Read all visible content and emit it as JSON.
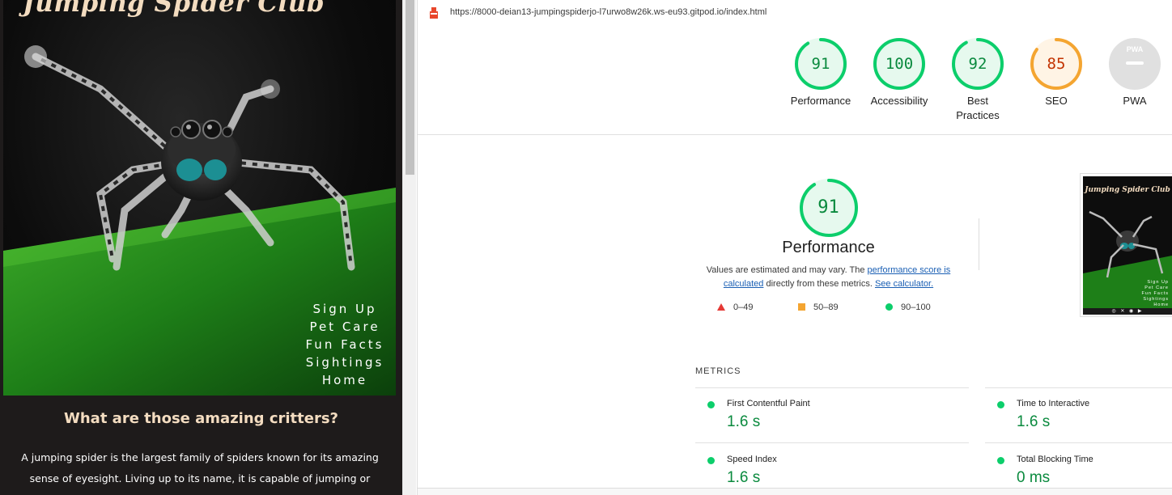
{
  "site": {
    "title": "Jumping Spider Club",
    "nav": [
      "Sign Up",
      "Pet Care",
      "Fun Facts",
      "Sightings",
      "Home"
    ],
    "heading": "What are those amazing critters?",
    "paragraph": "A jumping spider is the largest family of spiders known for its amazing sense of eyesight. Living up to its name, it is capable of jumping or"
  },
  "report": {
    "url": "https://8000-deian13-jumpingspiderjo-l7urwo8w26k.ws-eu93.gitpod.io/index.html",
    "gauges": [
      {
        "label": "Performance",
        "value": "91",
        "score": 0.91,
        "color": "#0cce6b",
        "text_color": "#0a8a3e",
        "bg": "#e6f9ee"
      },
      {
        "label": "Accessibility",
        "value": "100",
        "score": 1.0,
        "color": "#0cce6b",
        "text_color": "#0a8a3e",
        "bg": "#e6f9ee"
      },
      {
        "label": "Best Practices",
        "value": "92",
        "score": 0.92,
        "color": "#0cce6b",
        "text_color": "#0a8a3e",
        "bg": "#e6f9ee"
      },
      {
        "label": "SEO",
        "value": "85",
        "score": 0.85,
        "color": "#f4a531",
        "text_color": "#c33300",
        "bg": "#fff4e5"
      },
      {
        "label": "PWA",
        "value": "PWA",
        "score": 0,
        "color": "#e0e0e0",
        "text_color": "#ffffff",
        "bg": "#e0e0e0"
      }
    ],
    "performance": {
      "score": "91",
      "score_fraction": 0.91,
      "title": "Performance",
      "desc_before": "Values are estimated and may vary. The ",
      "link1": "performance score is calculated",
      "desc_middle": " directly from these metrics. ",
      "link2": "See calculator."
    },
    "legend": {
      "fail": "0–49",
      "average": "50–89",
      "pass": "90–100"
    },
    "thumbnail": {
      "title": "Jumping Spider Club",
      "nav": [
        "Sign Up",
        "Pet Care",
        "Fun Facts",
        "Sightings",
        "Home"
      ]
    },
    "metrics_heading": "METRICS",
    "metrics": [
      {
        "name": "First Contentful Paint",
        "value": "1.6 s"
      },
      {
        "name": "Time to Interactive",
        "value": "1.6 s"
      },
      {
        "name": "Speed Index",
        "value": "1.6 s"
      },
      {
        "name": "Total Blocking Time",
        "value": "0 ms"
      }
    ]
  }
}
